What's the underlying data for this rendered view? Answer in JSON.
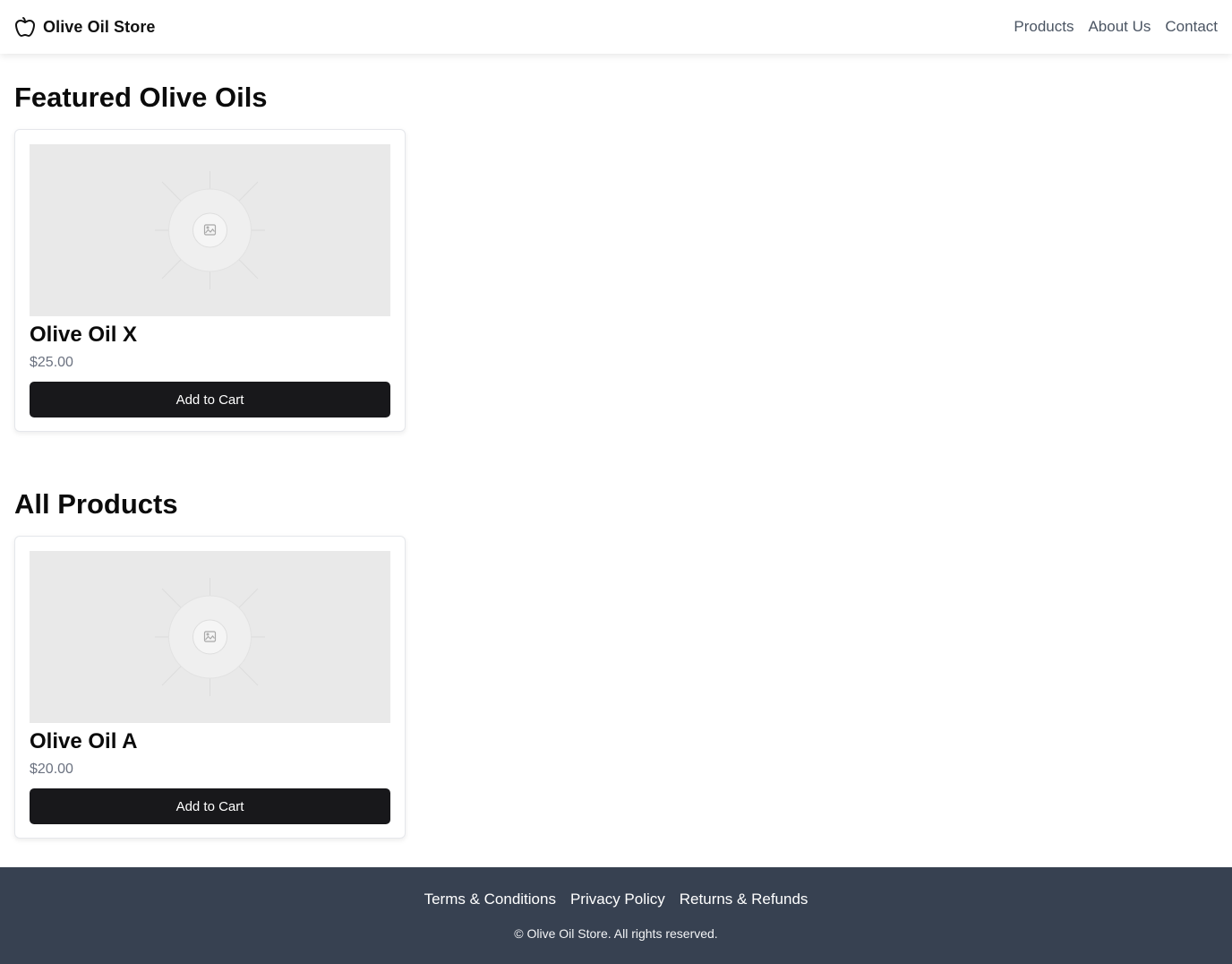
{
  "header": {
    "brand_name": "Olive Oil Store",
    "brand_icon": "apple-icon",
    "nav": [
      {
        "label": "Products"
      },
      {
        "label": "About Us"
      },
      {
        "label": "Contact"
      }
    ]
  },
  "sections": {
    "featured": {
      "title": "Featured Olive Oils",
      "products": [
        {
          "name": "Olive Oil X",
          "price": "$25.00",
          "button_label": "Add to Cart",
          "image_icon": "image-placeholder-icon"
        }
      ]
    },
    "all": {
      "title": "All Products",
      "products": [
        {
          "name": "Olive Oil A",
          "price": "$20.00",
          "button_label": "Add to Cart",
          "image_icon": "image-placeholder-icon"
        }
      ]
    }
  },
  "footer": {
    "links": [
      {
        "label": "Terms & Conditions"
      },
      {
        "label": "Privacy Policy"
      },
      {
        "label": "Returns & Refunds"
      }
    ],
    "copyright": "© Olive Oil Store. All rights reserved."
  },
  "colors": {
    "button_bg": "#18181b",
    "footer_bg": "#374151",
    "price_text": "#6b7280",
    "nav_text": "#4b5563"
  }
}
